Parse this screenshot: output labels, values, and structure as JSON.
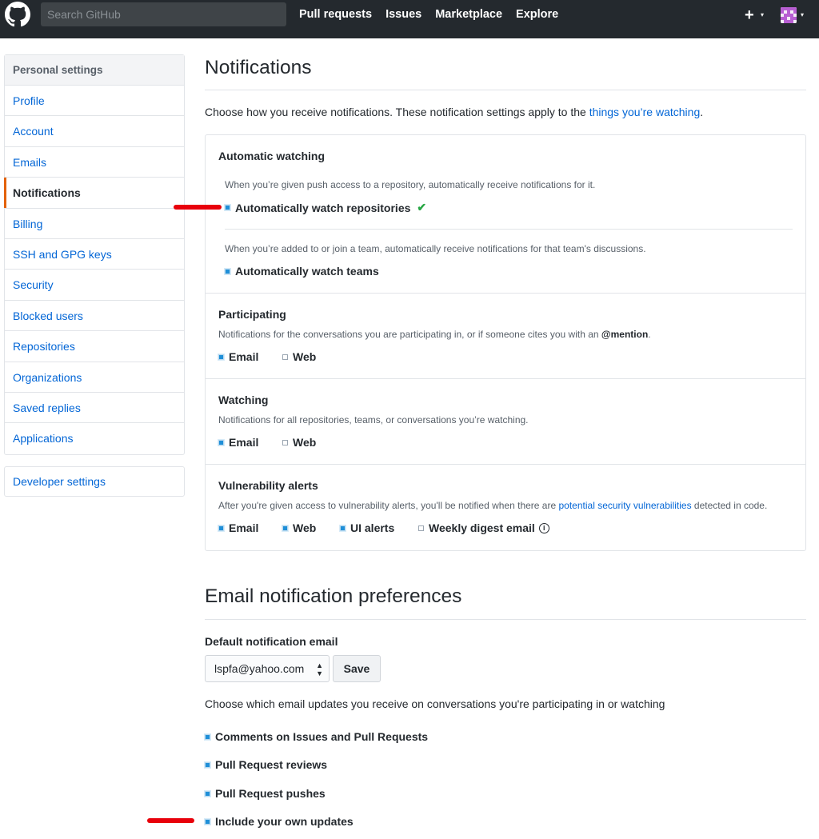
{
  "header": {
    "search_placeholder": "Search GitHub",
    "nav": [
      "Pull requests",
      "Issues",
      "Marketplace",
      "Explore"
    ],
    "plus": "+",
    "caret": "▾"
  },
  "sidebar": {
    "heading": "Personal settings",
    "items": [
      {
        "label": "Profile"
      },
      {
        "label": "Account"
      },
      {
        "label": "Emails"
      },
      {
        "label": "Notifications",
        "selected": true
      },
      {
        "label": "Billing"
      },
      {
        "label": "SSH and GPG keys"
      },
      {
        "label": "Security"
      },
      {
        "label": "Blocked users"
      },
      {
        "label": "Repositories"
      },
      {
        "label": "Organizations"
      },
      {
        "label": "Saved replies"
      },
      {
        "label": "Applications"
      }
    ],
    "developer": "Developer settings"
  },
  "main": {
    "title": "Notifications",
    "intro_prefix": "Choose how you receive notifications. These notification settings apply to the ",
    "intro_link": "things you’re watching",
    "intro_suffix": ".",
    "automatic": {
      "title": "Automatic watching",
      "repo_note": "When you’re given push access to a repository, automatically receive notifications for it.",
      "repo_label": "Automatically watch repositories",
      "repo_checked": true,
      "team_note": "When you’re added to or join a team, automatically receive notifications for that team's discussions.",
      "team_label": "Automatically watch teams",
      "team_checked": true
    },
    "participating": {
      "title": "Participating",
      "note": "Notifications for the conversations you are participating in, or if someone cites you with an ",
      "note_mention": "@mention",
      "note_end": ".",
      "email": "Email",
      "email_checked": true,
      "web": "Web",
      "web_checked": false
    },
    "watching": {
      "title": "Watching",
      "note": "Notifications for all repositories, teams, or conversations you’re watching.",
      "email": "Email",
      "email_checked": true,
      "web": "Web",
      "web_checked": false
    },
    "vulnerability": {
      "title": "Vulnerability alerts",
      "note_prefix": "After you're given access to vulnerability alerts, you'll be notified when there are ",
      "note_link": "potential security vulnerabilities",
      "note_suffix": " detected in code.",
      "email": "Email",
      "email_checked": true,
      "web": "Web",
      "web_checked": true,
      "ui": "UI alerts",
      "ui_checked": true,
      "digest": "Weekly digest email",
      "digest_checked": false
    }
  },
  "email_prefs": {
    "title": "Email notification preferences",
    "default_label": "Default notification email",
    "selected_email": "lspfa@yahoo.com",
    "save": "Save",
    "choose": "Choose which email updates you receive on conversations you're participating in or watching",
    "options": [
      {
        "label": "Comments on Issues and Pull Requests",
        "checked": true
      },
      {
        "label": "Pull Request reviews",
        "checked": true
      },
      {
        "label": "Pull Request pushes",
        "checked": true
      },
      {
        "label": "Include your own updates",
        "checked": true
      }
    ]
  },
  "colors": {
    "header_bg": "#24292e",
    "link": "#0366d6",
    "selected_accent": "#e36209",
    "check": "#28a745",
    "annotation_red": "#e8000b"
  }
}
